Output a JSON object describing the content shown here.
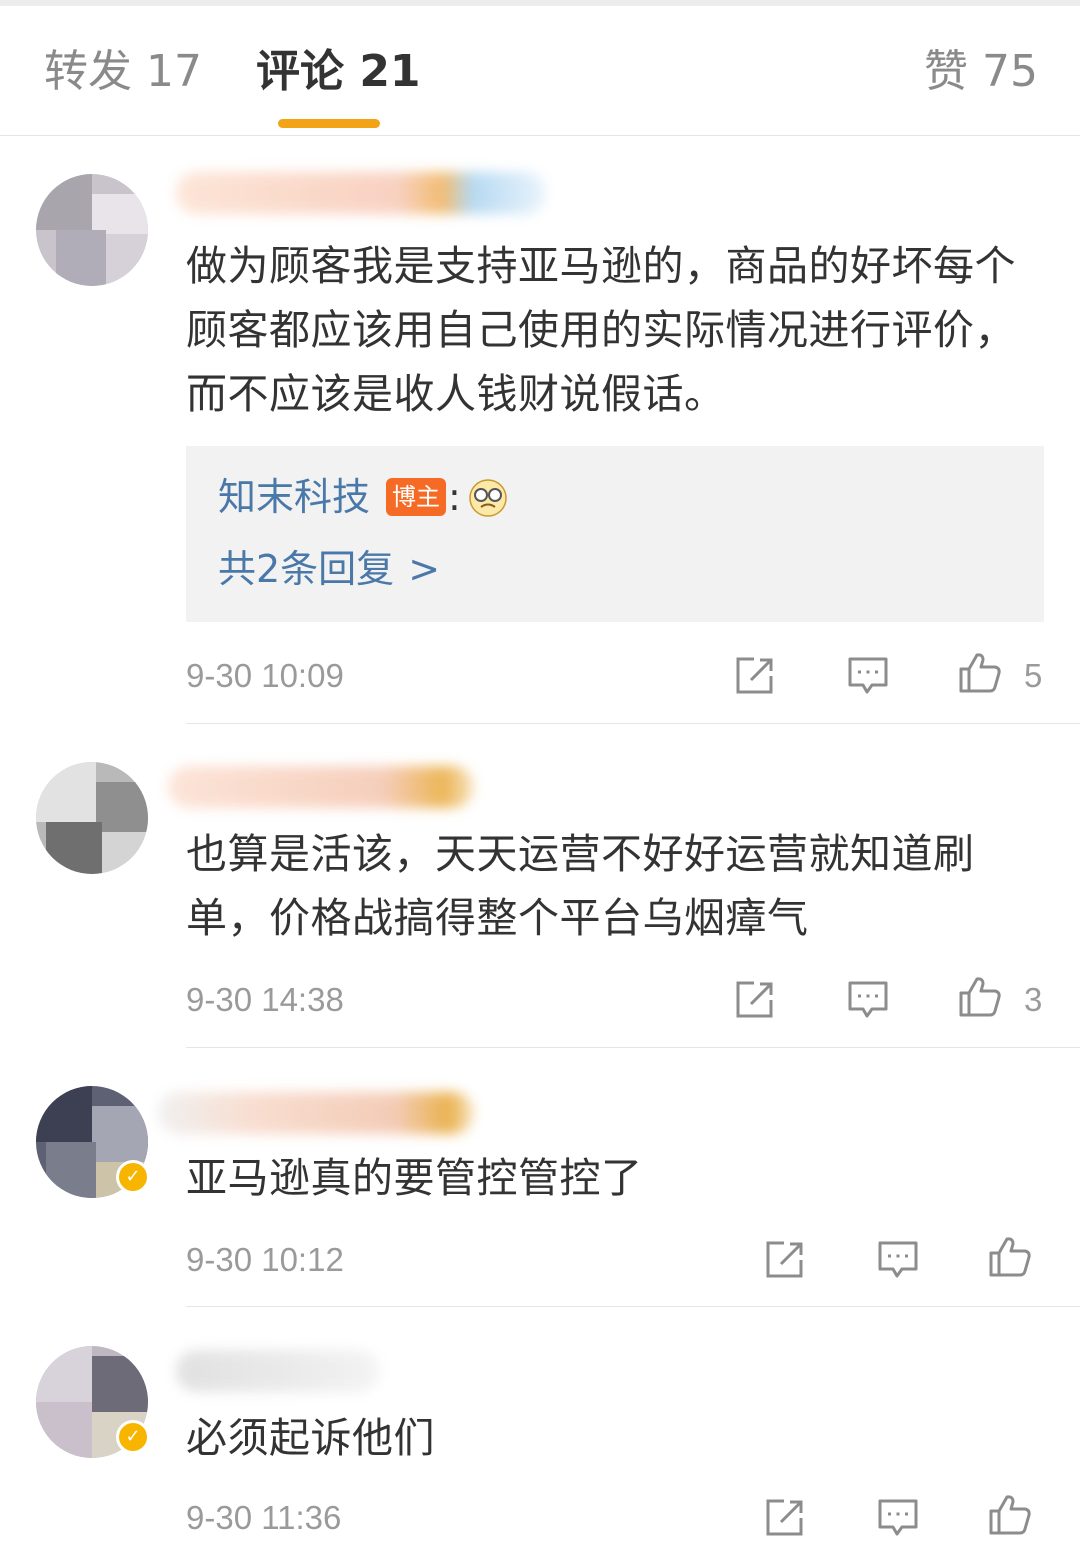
{
  "tabs": {
    "reposts": "转发 17",
    "comments": "评论 21",
    "likes": "赞 75"
  },
  "icons": {
    "share": "share-icon",
    "reply": "comment-icon",
    "like": "thumb-up-icon",
    "chevron": "chevron-right-icon"
  },
  "colors": {
    "accent": "#f2a416",
    "link": "#4a78a8",
    "host_badge": "#f56b25",
    "verified_badge": "#f7b500"
  },
  "comments": [
    {
      "text": "做为顾客我是支持亚马逊的，商品的好坏每个顾客都应该用自己使用的实际情况进行评价，而不应该是收人钱财说假话。",
      "time": "9-30 10:09",
      "likes": "5",
      "reply": {
        "author": "知末科技",
        "badge": "博主",
        "colon": ":",
        "more": "共2条回复",
        "more_arrow": ">"
      }
    },
    {
      "text": "也算是活该，天天运营不好好运营就知道刷单，价格战搞得整个平台乌烟瘴气",
      "time": "9-30 14:38",
      "likes": "3"
    },
    {
      "text": "亚马逊真的要管控管控了",
      "time": "9-30 10:12",
      "likes": ""
    },
    {
      "text": "必须起诉他们",
      "time": "9-30 11:36",
      "likes": ""
    }
  ]
}
